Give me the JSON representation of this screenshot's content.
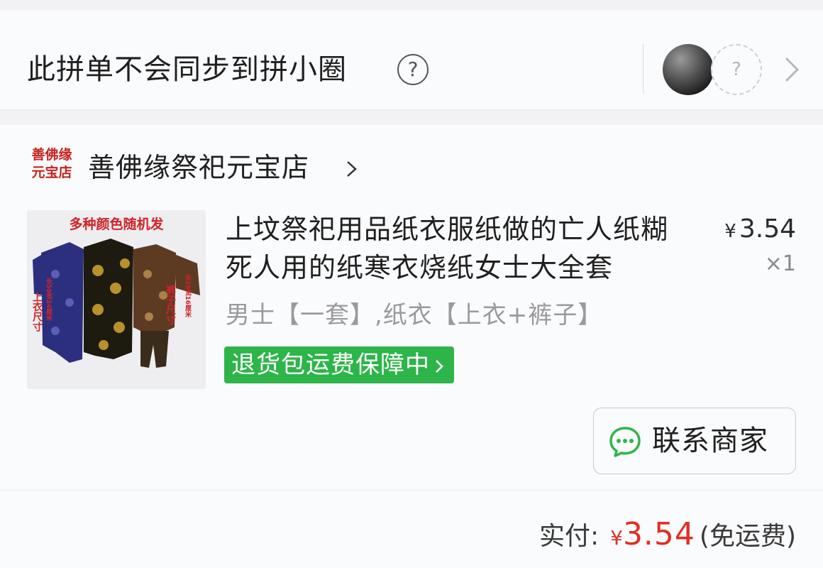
{
  "sync": {
    "text": "此拼单不会同步到拼小圈",
    "help_glyph": "?",
    "empty_slot_glyph": "?"
  },
  "shop": {
    "logo_line1": "善佛缘",
    "logo_line2": "元宝店",
    "name": "善佛缘祭祀元宝店"
  },
  "product": {
    "image_banner": "多种颜色随机发",
    "image_label_left": "上衣尺寸",
    "image_label_left_small": "长50宽34厘米",
    "image_label_right": "裤子尺寸",
    "image_label_right_small": "长28宽16厘米",
    "title": "上坟祭祀用品纸衣服纸做的亡人纸糊死人用的纸寒衣烧纸女士大全套",
    "price_symbol": "¥",
    "price": "3.54",
    "quantity": "×1",
    "sku": "男士【一套】,纸衣【上衣+裤子】",
    "guarantee": "退货包运费保障中"
  },
  "actions": {
    "contact_label": "联系商家"
  },
  "payment": {
    "label": "实付:",
    "symbol": "¥",
    "amount": "3.54",
    "note": "(免运费)"
  },
  "colors": {
    "accent_red": "#e02e24",
    "guarantee_green": "#2db54a",
    "logo_red": "#c5241e"
  }
}
